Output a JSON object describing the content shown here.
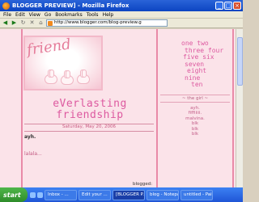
{
  "window": {
    "title": "BLOGGER PREVIEW] - Mozilla Firefox",
    "controls": [
      "_",
      "□",
      "×"
    ]
  },
  "menu": [
    "File",
    "Edit",
    "View",
    "Go",
    "Bookmarks",
    "Tools",
    "Help"
  ],
  "toolbar": {
    "address": "http://www.blogger.com/blog-preview.g"
  },
  "blog": {
    "sticker_text": "friend",
    "title_line1": "eVerlasting",
    "title_line2": "friendship",
    "date": "Saturday, May 20, 2006",
    "post_title": "ayh.",
    "post_body": "lalala...",
    "byline": "blogged:"
  },
  "sidebar": {
    "numbers": [
      "one",
      "two",
      "three",
      "four",
      "five",
      "six",
      "seven",
      "eight",
      "nine",
      "ten"
    ],
    "heading": "~ the girl ~",
    "links": [
      "ayh.",
      "fiffiiiii.",
      "malvina.",
      "blk",
      "blk",
      "blk"
    ]
  },
  "taskbar": {
    "start": "start",
    "tasks": [
      "Inbox - ...",
      "Edit your ...",
      "[BLOGGER P...",
      "blog - Notepad",
      "untitled - Paint"
    ]
  },
  "colors": {
    "accent": "#dd5aa0",
    "page_bg": "#fbe3e9",
    "stripe": "#e98aa8"
  }
}
